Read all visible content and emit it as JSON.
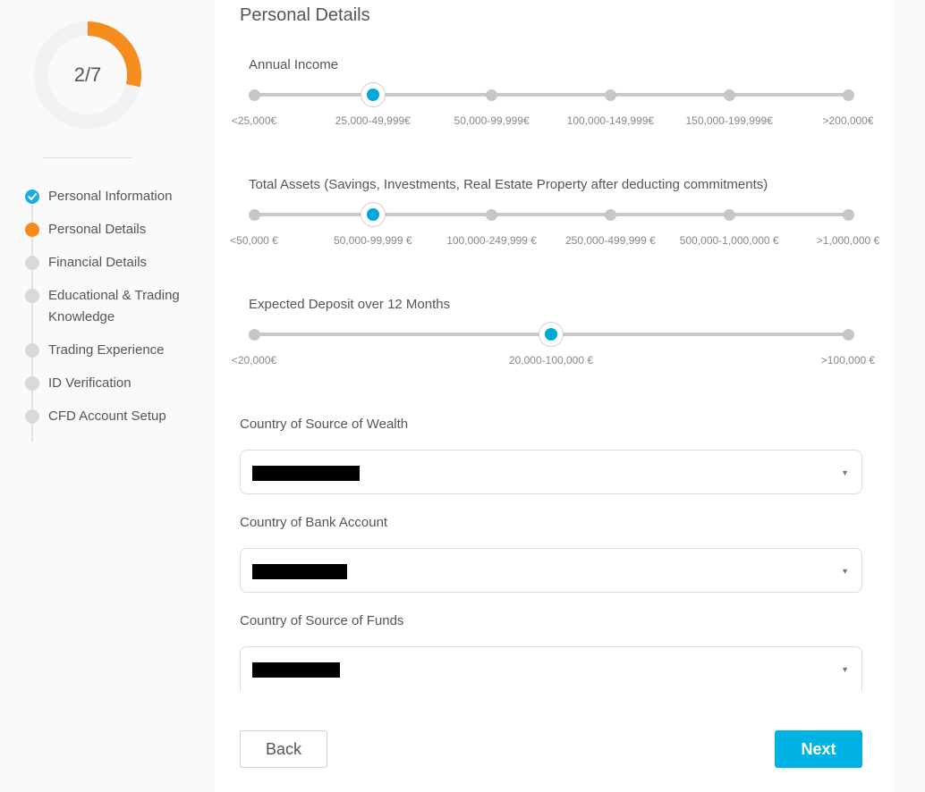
{
  "progress": {
    "label": "2/7",
    "current_step": 2,
    "total_steps": 7,
    "fraction": 0.2857
  },
  "steps": [
    {
      "label": "Personal Information",
      "status": "done"
    },
    {
      "label": "Personal Details",
      "status": "current"
    },
    {
      "label": "Financial Details",
      "status": "pending"
    },
    {
      "label": "Educational & Trading Knowledge",
      "status": "pending"
    },
    {
      "label": "Trading Experience",
      "status": "pending"
    },
    {
      "label": "ID Verification",
      "status": "pending"
    },
    {
      "label": "CFD Account Setup",
      "status": "pending"
    }
  ],
  "page_title": "Personal Details",
  "sliders": {
    "annual_income": {
      "title": "Annual Income",
      "options": [
        "<25,000€",
        "25,000-49,999€",
        "50,000-99,999€",
        "100,000-149,999€",
        "150,000-199,999€",
        ">200,000€"
      ],
      "selected_index": 1
    },
    "total_assets": {
      "title": "Total Assets (Savings, Investments, Real Estate Property after deducting commitments)",
      "options": [
        "<50,000 €",
        "50,000-99,999 €",
        "100,000-249,999 €",
        "250,000-499,999 €",
        "500,000-1,000,000 €",
        ">1,000,000 €"
      ],
      "selected_index": 1
    },
    "expected_deposit": {
      "title": "Expected Deposit over 12 Months",
      "options": [
        "<20,000€",
        "20,000-100,000 €",
        ">100,000 €"
      ],
      "selected_index": 1
    }
  },
  "fields": {
    "wealth_country": {
      "label": "Country of Source of Wealth",
      "value": "[redacted]"
    },
    "bank_country": {
      "label": "Country of Bank Account",
      "value": "[redacted]"
    },
    "funds_country": {
      "label": "Country of Source of Funds",
      "value": "[redacted]"
    }
  },
  "buttons": {
    "back": "Back",
    "next": "Next"
  },
  "colors": {
    "accent": "#00b3e3",
    "progress": "#f68c1e",
    "done": "#1aaee0",
    "pending": "#d9d9d9"
  },
  "icons": {
    "dropdown": "caret-down-icon",
    "done": "check-circle-icon"
  }
}
